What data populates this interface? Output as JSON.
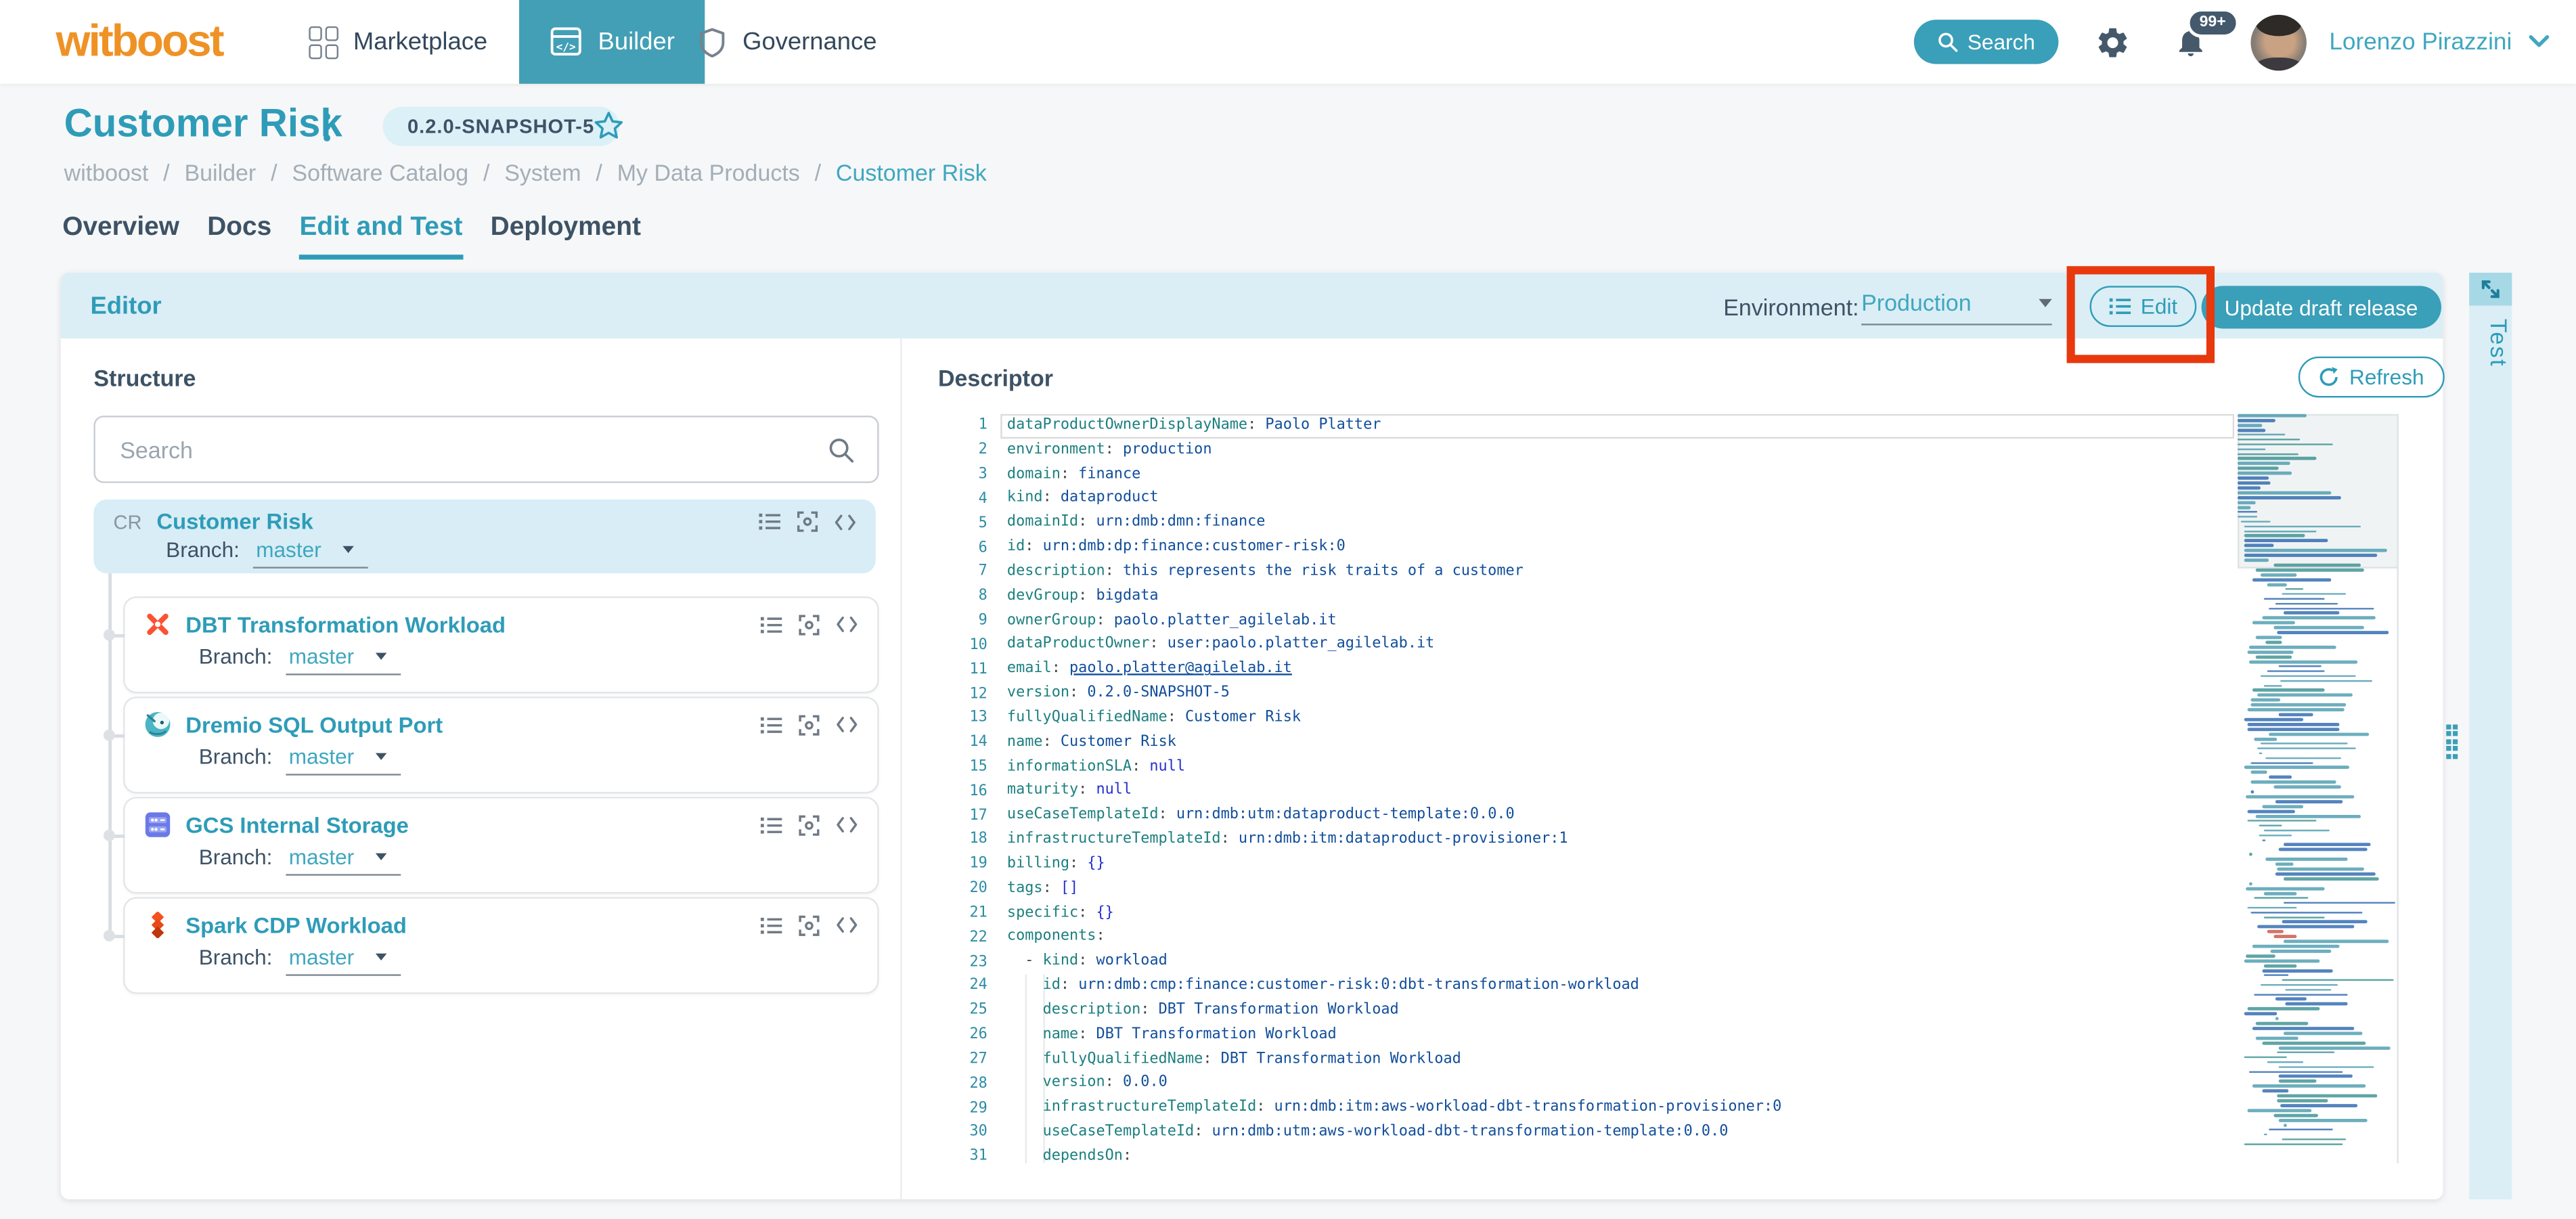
{
  "navbar": {
    "logo": "witboost",
    "items": [
      {
        "label": "Marketplace",
        "icon": "marketplace-grid-icon",
        "active": false
      },
      {
        "label": "Builder",
        "icon": "builder-window-code-icon",
        "active": true
      },
      {
        "label": "Governance",
        "icon": "shield-icon",
        "active": false
      }
    ],
    "search_label": "Search",
    "notification_count": "99+",
    "user_name": "Lorenzo Pirazzini"
  },
  "page": {
    "title": "Customer Risk",
    "version_badge": "0.2.0-SNAPSHOT-5",
    "breadcrumb": [
      "witboost",
      "Builder",
      "Software Catalog",
      "System",
      "My Data Products",
      "Customer Risk"
    ],
    "tabs": [
      {
        "label": "Overview",
        "active": false
      },
      {
        "label": "Docs",
        "active": false
      },
      {
        "label": "Edit and Test",
        "active": true
      },
      {
        "label": "Deployment",
        "active": false
      }
    ]
  },
  "editor": {
    "title": "Editor",
    "environment_label": "Environment:",
    "environment_value": "Production",
    "edit_button": "Edit",
    "update_button": "Update draft release",
    "structure": {
      "title": "Structure",
      "search_placeholder": "Search",
      "root": {
        "abbr": "CR",
        "name": "Customer Risk",
        "branch_label": "Branch:",
        "branch": "master"
      },
      "components": [
        {
          "name": "DBT Transformation Workload",
          "icon": "dbt-icon",
          "branch_label": "Branch:",
          "branch": "master"
        },
        {
          "name": "Dremio SQL Output Port",
          "icon": "dremio-icon",
          "branch_label": "Branch:",
          "branch": "master"
        },
        {
          "name": "GCS Internal Storage",
          "icon": "gcs-icon",
          "branch_label": "Branch:",
          "branch": "master"
        },
        {
          "name": "Spark CDP Workload",
          "icon": "spark-icon",
          "branch_label": "Branch:",
          "branch": "master"
        }
      ]
    },
    "descriptor": {
      "title": "Descriptor",
      "refresh_button": "Refresh",
      "lines": [
        {
          "key": "dataProductOwnerDisplayName",
          "value": "Paolo Platter",
          "indent": 0
        },
        {
          "key": "environment",
          "value": "production",
          "indent": 0
        },
        {
          "key": "domain",
          "value": "finance",
          "indent": 0
        },
        {
          "key": "kind",
          "value": "dataproduct",
          "indent": 0
        },
        {
          "key": "domainId",
          "value": "urn:dmb:dmn:finance",
          "indent": 0
        },
        {
          "key": "id",
          "value": "urn:dmb:dp:finance:customer-risk:0",
          "indent": 0
        },
        {
          "key": "description",
          "value": "this represents the risk traits of a customer",
          "indent": 0
        },
        {
          "key": "devGroup",
          "value": "bigdata",
          "indent": 0
        },
        {
          "key": "ownerGroup",
          "value": "paolo.platter_agilelab.it",
          "indent": 0
        },
        {
          "key": "dataProductOwner",
          "value": "user:paolo.platter_agilelab.it",
          "indent": 0
        },
        {
          "key": "email",
          "value": "paolo.platter@agilelab.it",
          "indent": 0,
          "link": true
        },
        {
          "key": "version",
          "value": "0.2.0-SNAPSHOT-5",
          "indent": 0
        },
        {
          "key": "fullyQualifiedName",
          "value": "Customer Risk",
          "indent": 0
        },
        {
          "key": "name",
          "value": "Customer Risk",
          "indent": 0
        },
        {
          "key": "informationSLA",
          "value": "null",
          "indent": 0,
          "special": true
        },
        {
          "key": "maturity",
          "value": "null",
          "indent": 0,
          "special": true
        },
        {
          "key": "useCaseTemplateId",
          "value": "urn:dmb:utm:dataproduct-template:0.0.0",
          "indent": 0
        },
        {
          "key": "infrastructureTemplateId",
          "value": "urn:dmb:itm:dataproduct-provisioner:1",
          "indent": 0
        },
        {
          "key": "billing",
          "value": "{}",
          "indent": 0,
          "special": true
        },
        {
          "key": "tags",
          "value": "[]",
          "indent": 0,
          "special": true
        },
        {
          "key": "specific",
          "value": "{}",
          "indent": 0,
          "special": true
        },
        {
          "key": "components",
          "value": "",
          "indent": 0
        },
        {
          "key": "kind",
          "value": "workload",
          "indent": 2,
          "dash": true
        },
        {
          "key": "id",
          "value": "urn:dmb:cmp:finance:customer-risk:0:dbt-transformation-workload",
          "indent": 4
        },
        {
          "key": "description",
          "value": "DBT Transformation Workload",
          "indent": 4
        },
        {
          "key": "name",
          "value": "DBT Transformation Workload",
          "indent": 4
        },
        {
          "key": "fullyQualifiedName",
          "value": "DBT Transformation Workload",
          "indent": 4
        },
        {
          "key": "version",
          "value": "0.0.0",
          "indent": 4
        },
        {
          "key": "infrastructureTemplateId",
          "value": "urn:dmb:itm:aws-workload-dbt-transformation-provisioner:0",
          "indent": 4
        },
        {
          "key": "useCaseTemplateId",
          "value": "urn:dmb:utm:aws-workload-dbt-transformation-template:0.0.0",
          "indent": 4
        },
        {
          "key": "dependsOn",
          "value": "",
          "indent": 4
        }
      ]
    }
  },
  "test_panel": {
    "label": "Test"
  },
  "colors": {
    "accent": "#2E9CB8",
    "accent_button": "#3A9FB8",
    "nav_active_bg": "#429FB5",
    "header_strip": "#DBEEF5",
    "root_card_bg": "#D8EDF6",
    "annotation_red": "#E8380D",
    "brand_orange": "#EF9226",
    "yaml_key": "#1C7F7F",
    "yaml_value": "#114E9B",
    "yaml_special": "#2430CF"
  }
}
